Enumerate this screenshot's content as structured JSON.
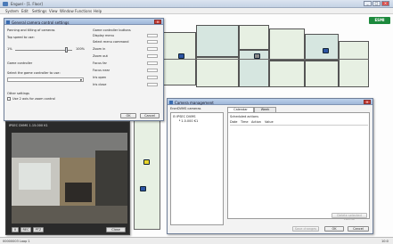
{
  "app": {
    "title": "Enguel - [1. Floor]",
    "menu": [
      "System",
      "Edit",
      "Settings",
      "View",
      "Window",
      "Functions",
      "Help"
    ],
    "window_controls": [
      "_",
      "□",
      "×"
    ],
    "logo_text": "ESMI",
    "status": {
      "left": "00000003  Loop 1",
      "right": "10:0"
    },
    "colors": {
      "accent": "#1d8a3d",
      "title_blue": "#9fb7d8",
      "floor": "#e7f0e3"
    }
  },
  "camera_settings": {
    "title": "General camera control settings",
    "section_pan_tilt": "Panning and tilting of cameras",
    "top_speed_label": "Top speed to use:",
    "slider_min": "1%",
    "slider_max": "100%",
    "slider_value_percent": 90,
    "section_game_controller": "Game controller",
    "select_controller_label": "Select the game controller to use:",
    "section_other": "Other settings",
    "zoom_checkbox_label": "Use 2 axis for zoom control",
    "buttons_header": "Game controller buttons",
    "button_actions": [
      "Display menu",
      "Select menu command",
      "Zoom in",
      "Zoom out",
      "Focus far",
      "Focus near",
      "Iris open",
      "Iris close"
    ],
    "ok": "OK",
    "cancel": "Cancel"
  },
  "camera_management": {
    "title": "Camera management",
    "list_header": "EnerDVMS cameras",
    "tree_root": "IPSEC DVMS",
    "tree_child": "1.0.000 K1",
    "tabs": [
      "Calendar controls",
      "Week settings"
    ],
    "scheduled_label": "Scheduled actions",
    "columns": [
      "Date",
      "Time",
      "Action",
      "Value"
    ],
    "delete_button": "Delete selected control",
    "save_button": "Save changes",
    "ok": "OK",
    "cancel": "Cancel"
  },
  "video": {
    "title": "IPSEC DVMS   1.15.000 K1",
    "toolbar_labels": [
      "II",
      "REC",
      "PTZ"
    ],
    "close_label": "Close"
  }
}
